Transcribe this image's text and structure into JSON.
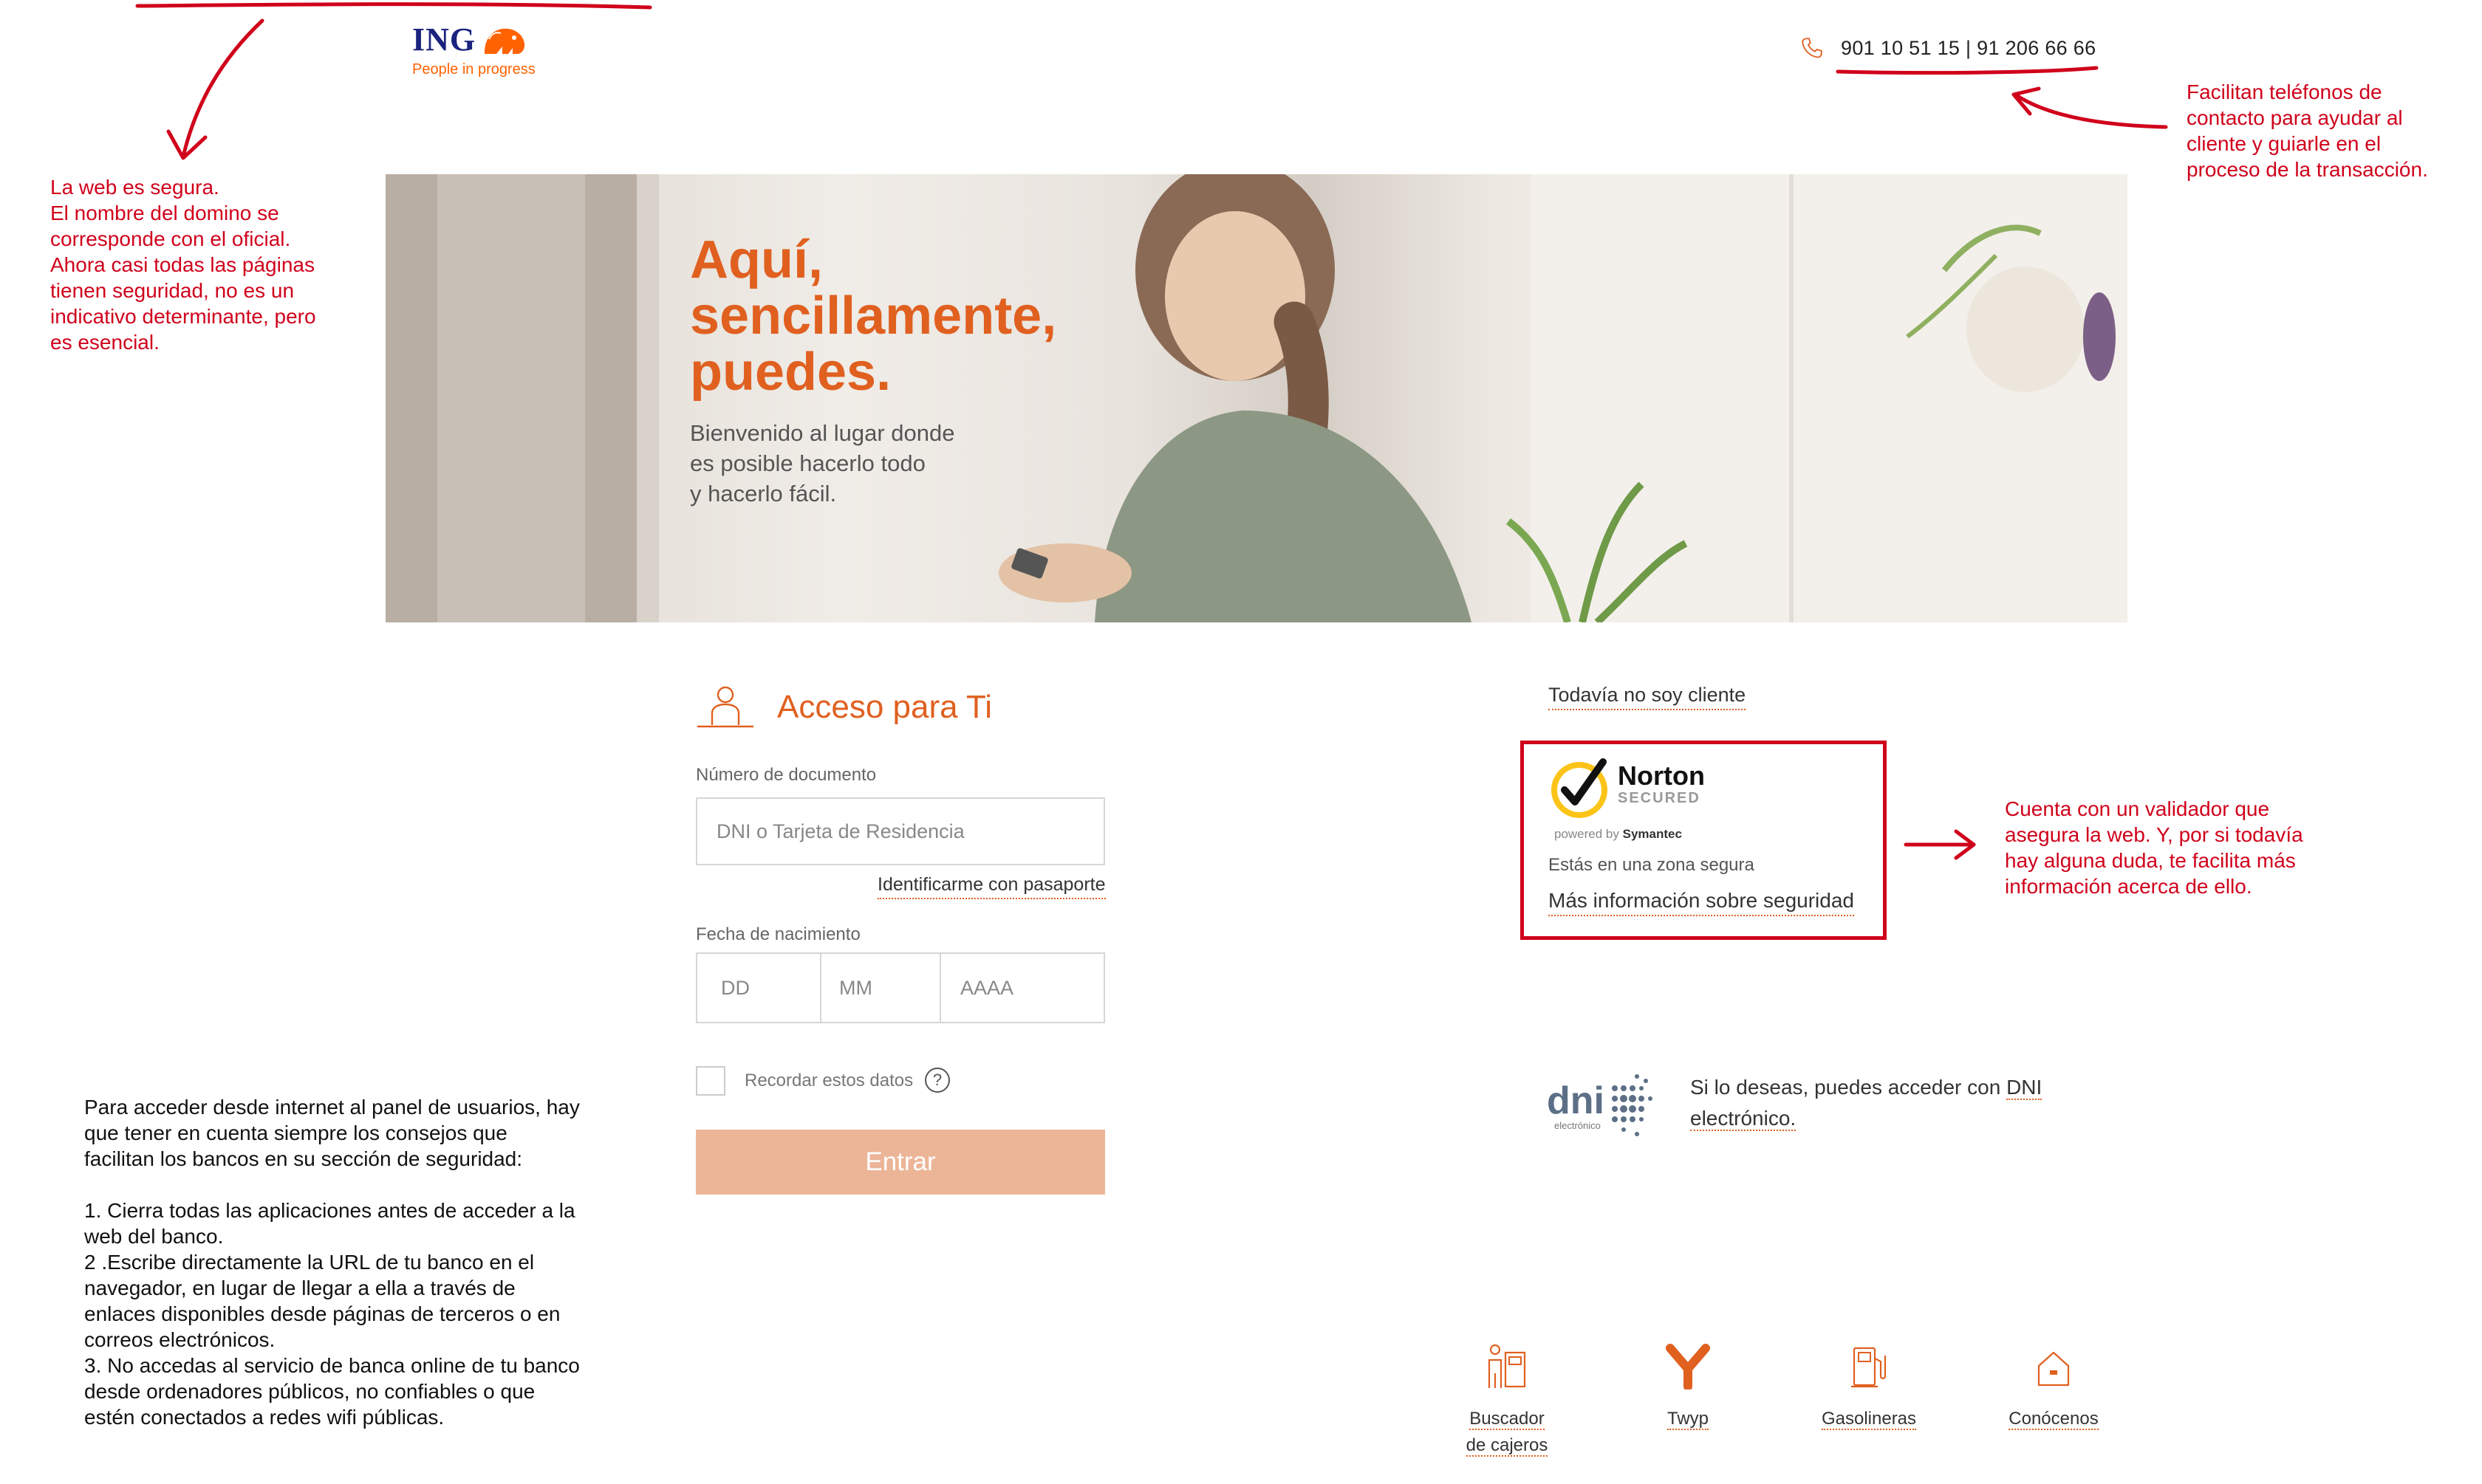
{
  "header": {
    "logo_name": "ING",
    "logo_tagline": "People in progress",
    "phone_numbers": "901 10 51 15 | 91 206 66 66"
  },
  "hero": {
    "title": "Aquí,\nsencillamente,\npuedes.",
    "subtitle": "Bienvenido al lugar donde\nes posible hacerlo todo\ny hacerlo fácil."
  },
  "login_form": {
    "title": "Acceso para Ti",
    "document_label": "Número de documento",
    "document_placeholder": "DNI o Tarjeta de Residencia",
    "passport_link": "Identificarme con pasaporte",
    "birthdate_label": "Fecha de nacimiento",
    "day_placeholder": "DD",
    "month_placeholder": "MM",
    "year_placeholder": "AAAA",
    "remember_label": "Recordar estos datos",
    "help_symbol": "?",
    "submit_label": "Entrar"
  },
  "side_panel": {
    "not_client_link": "Todavía no soy cliente",
    "norton_brand": "Norton",
    "norton_secured": "SECURED",
    "norton_powered": "powered by",
    "norton_symantec": "Symantec",
    "secure_zone_text": "Estás en una zona segura",
    "security_info_link": "Más información sobre seguridad",
    "dni_logo": "dni",
    "dni_logo_sub": "electrónico",
    "dni_text_prefix": "Si lo deseas, puedes acceder con ",
    "dni_link_1": "DNI",
    "dni_link_2": "electrónico."
  },
  "bottom_nav": {
    "atm_line1": "Buscador",
    "atm_line2": "de cajeros",
    "twyp": "Twyp",
    "gas": "Gasolineras",
    "about": "Conócenos"
  },
  "annotations": {
    "secure_web": "La web es segura.\nEl nombre del domino se\ncorresponde con el oficial.\nAhora casi todas las páginas\ntienen seguridad, no es un\nindicativo determinante, pero\nes esencial.",
    "phones": "Facilitan teléfonos de\ncontacto para ayudar al\ncliente y guiarle en el\nproceso de la transacción.",
    "validator": "Cuenta con un validador que\nasegura la web. Y, por si todavía\nhay alguna duda, te facilita más\ninformación acerca de ello.",
    "advice": "Para acceder desde internet al panel de usuarios, hay\nque tener en cuenta siempre los consejos que\nfacilitan los bancos en su sección de seguridad:\n\n1. Cierra todas las aplicaciones antes de acceder a la\nweb del banco.\n2 .Escribe directamente la URL de tu banco en el\nnavegador, en lugar de llegar a ella a través de\nenlaces disponibles desde páginas de terceros o en\ncorreos electrónicos.\n3. No accedas al servicio de banca online de tu banco\ndesde ordenadores públicos, no confiables o que\nestén conectados a redes wifi públicas."
  },
  "colors": {
    "brand_orange": "#ff6200",
    "ing_navy": "#1a237e",
    "annotation_red": "#d0021b",
    "button_disabled": "#ecb597"
  }
}
